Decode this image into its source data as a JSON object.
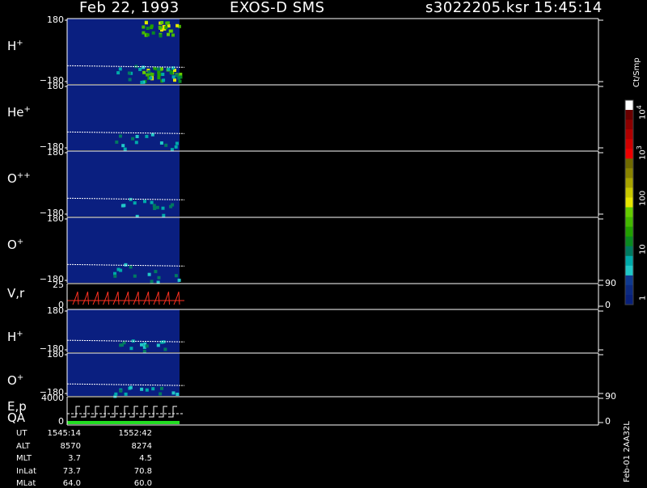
{
  "header": {
    "date": "Feb 22, 1993",
    "mission": "EXOS-D SMS",
    "file": "s3022205.ksr",
    "time": "15:45:14"
  },
  "panels": [
    {
      "label": "H",
      "sup": "+",
      "ytop": "180",
      "ybot": "−180"
    },
    {
      "label": "He",
      "sup": "+",
      "ytop": "180",
      "ybot": "−180"
    },
    {
      "label": "O",
      "sup": "++",
      "ytop": "180",
      "ybot": "−180"
    },
    {
      "label": "O",
      "sup": "+",
      "ytop": "180",
      "ybot": "−180"
    },
    {
      "label": "V,r",
      "sup": "",
      "ytop": "25",
      "ybot": "0",
      "rtop": "90",
      "rbot": "0"
    },
    {
      "label": "H",
      "sup": "+",
      "ytop": "180",
      "ybot": "−180"
    },
    {
      "label": "O",
      "sup": "+",
      "ytop": "180",
      "ybot": "−180"
    },
    {
      "label": "E,p",
      "sup": "",
      "label2": "QA",
      "ytop": "4000",
      "ybot": "0",
      "rtop": "90",
      "rbot": "0"
    }
  ],
  "colorbar": {
    "unit": "Ct/Smp",
    "ticks": [
      {
        "base": "10",
        "exp": "4"
      },
      {
        "base": "10",
        "exp": "3"
      },
      {
        "base": "100",
        "exp": ""
      },
      {
        "base": "10",
        "exp": ""
      },
      {
        "base": "1",
        "exp": ""
      }
    ],
    "colors": [
      "#ffffff",
      "#6a0000",
      "#8c0000",
      "#b00000",
      "#d00000",
      "#ee0000",
      "#706a00",
      "#8a8400",
      "#a8a400",
      "#c8c800",
      "#e6e600",
      "#66cc00",
      "#44b800",
      "#22a000",
      "#0a8a20",
      "#007a60",
      "#00aaaa",
      "#20c8c8",
      "#103a90",
      "#0c2a80",
      "#08207a"
    ]
  },
  "orbit_table": {
    "rows": [
      {
        "label": "UT",
        "values": [
          "1545:14",
          "1552:42"
        ]
      },
      {
        "label": "ALT",
        "values": [
          "8570",
          "8274"
        ]
      },
      {
        "label": "MLT",
        "values": [
          "3.7",
          "4.5"
        ]
      },
      {
        "label": "InLat",
        "values": [
          "73.7",
          "70.8"
        ]
      },
      {
        "label": "MLat",
        "values": [
          "64.0",
          "60.0"
        ]
      }
    ]
  },
  "footer_id": "Feb-01 2AA32L",
  "chart_data": {
    "type": "heatmap",
    "title": "Feb 22, 1993   EXOS-D SMS",
    "series": [
      {
        "name": "H+",
        "ylim": [
          -180,
          180
        ]
      },
      {
        "name": "He+",
        "ylim": [
          -180,
          180
        ]
      },
      {
        "name": "O++",
        "ylim": [
          -180,
          180
        ]
      },
      {
        "name": "O+",
        "ylim": [
          -180,
          180
        ]
      },
      {
        "name": "V,r",
        "ylim": [
          0,
          25
        ]
      },
      {
        "name": "H+",
        "ylim": [
          -180,
          180
        ]
      },
      {
        "name": "O+",
        "ylim": [
          -180,
          180
        ]
      },
      {
        "name": "E,p",
        "ylim": [
          0,
          4000
        ]
      }
    ],
    "x": [
      "1545:14",
      "1552:42"
    ],
    "colorbar_scale": "log",
    "colorbar_range": [
      1,
      10000
    ]
  }
}
